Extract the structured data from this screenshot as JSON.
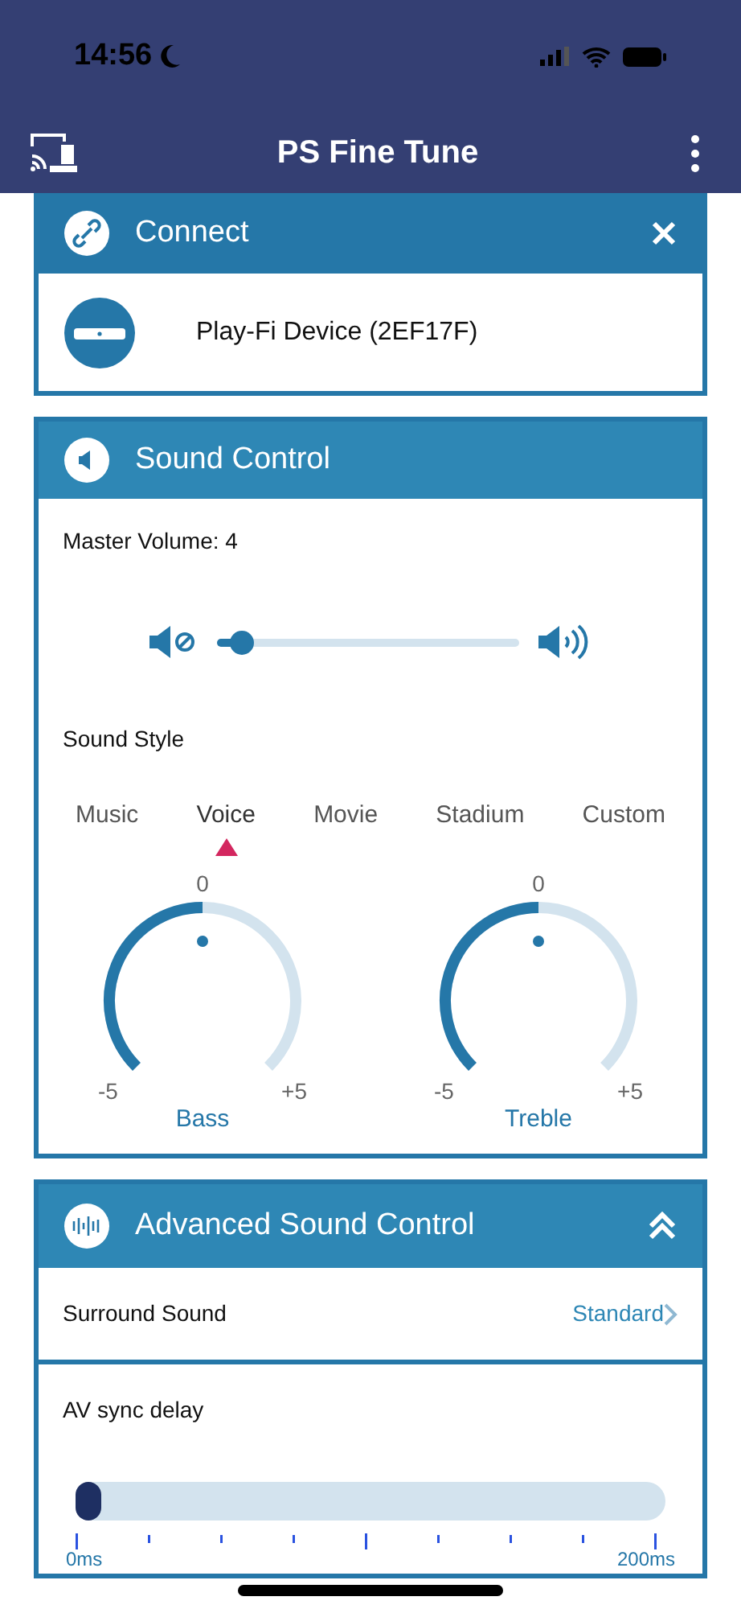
{
  "status_bar": {
    "time": "14:56"
  },
  "app_bar": {
    "title": "PS Fine Tune"
  },
  "connect": {
    "title": "Connect",
    "device": "Play-Fi Device (2EF17F)"
  },
  "sound_control": {
    "title": "Sound Control",
    "master_volume_label": "Master Volume: 4",
    "volume": {
      "level": 0.08
    },
    "sound_style_label": "Sound Style",
    "styles": [
      {
        "label": "Music",
        "selected": false
      },
      {
        "label": "Voice",
        "selected": true
      },
      {
        "label": "Movie",
        "selected": false
      },
      {
        "label": "Stadium",
        "selected": false
      },
      {
        "label": "Custom",
        "selected": false
      }
    ],
    "dials": [
      {
        "name": "Bass",
        "value": "0",
        "min": "-5",
        "max": "+5"
      },
      {
        "name": "Treble",
        "value": "0",
        "min": "-5",
        "max": "+5"
      }
    ]
  },
  "advanced": {
    "title": "Advanced Sound Control",
    "expanded": true,
    "surround_label": "Surround Sound",
    "surround_value": "Standard",
    "av_sync_label": "AV sync delay",
    "av_sync": {
      "level": 0,
      "min": "0ms",
      "max": "200ms"
    }
  }
}
